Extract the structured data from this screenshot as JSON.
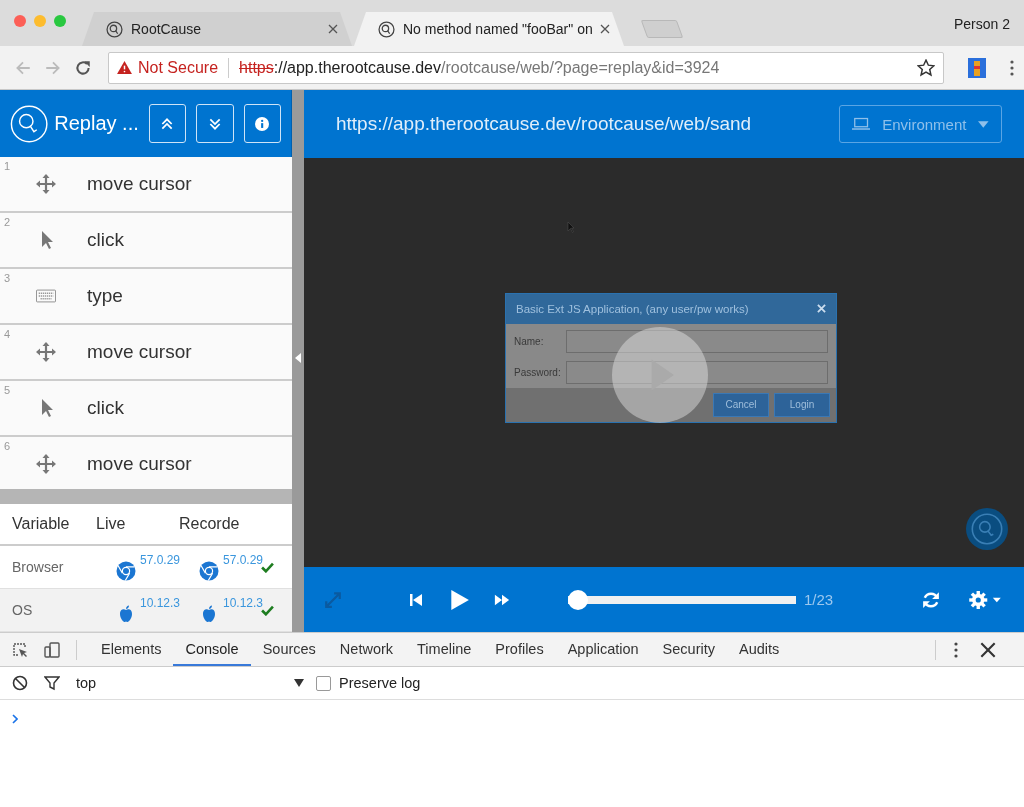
{
  "browser": {
    "tabs": [
      {
        "title": "RootCause",
        "selected": false
      },
      {
        "title": "No method named \"fooBar\" on",
        "selected": true
      }
    ],
    "profile": "Person 2",
    "address": {
      "security": "Not Secure",
      "scheme": "https",
      "host": "://app.therootcause.dev",
      "path": "/rootcause/web/?page=replay&id=3924"
    }
  },
  "sidebar": {
    "title": "Replay ...",
    "steps": [
      {
        "number": "1",
        "kind": "move",
        "label": "move cursor"
      },
      {
        "number": "2",
        "kind": "click",
        "label": "click"
      },
      {
        "number": "3",
        "kind": "type",
        "label": "type"
      },
      {
        "number": "4",
        "kind": "move",
        "label": "move cursor"
      },
      {
        "number": "5",
        "kind": "click",
        "label": "click"
      },
      {
        "number": "6",
        "kind": "move",
        "label": "move cursor"
      }
    ],
    "variables": {
      "columns": [
        "Variable",
        "Live",
        "Recorde"
      ],
      "rows": [
        {
          "name": "Browser",
          "live": {
            "kind": "chrome",
            "version": "57.0.29"
          },
          "recorded": {
            "kind": "chrome",
            "version": "57.0.29"
          },
          "match": true
        },
        {
          "name": "OS",
          "live": {
            "kind": "apple",
            "version": "10.12.3"
          },
          "recorded": {
            "kind": "apple",
            "version": "10.12.3"
          },
          "match": true
        }
      ]
    }
  },
  "player": {
    "url": "https://app.therootcause.dev/rootcause/web/sand",
    "environment": "Environment",
    "dialog": {
      "title": "Basic Ext JS Application, (any user/pw works)",
      "fields": [
        "Name:",
        "Password:"
      ],
      "buttons": [
        "Cancel",
        "Login"
      ]
    },
    "progress": {
      "level": 0,
      "counter": "1/23"
    }
  },
  "devtools": {
    "tabs": [
      {
        "label": "Elements",
        "selected": false
      },
      {
        "label": "Console",
        "selected": true
      },
      {
        "label": "Sources",
        "selected": false
      },
      {
        "label": "Network",
        "selected": false
      },
      {
        "label": "Timeline",
        "selected": false
      },
      {
        "label": "Profiles",
        "selected": false
      },
      {
        "label": "Application",
        "selected": false
      },
      {
        "label": "Security",
        "selected": false
      },
      {
        "label": "Audits",
        "selected": false
      }
    ],
    "context": "top",
    "preserve_log": {
      "label": "Preserve log",
      "checked": false
    }
  }
}
